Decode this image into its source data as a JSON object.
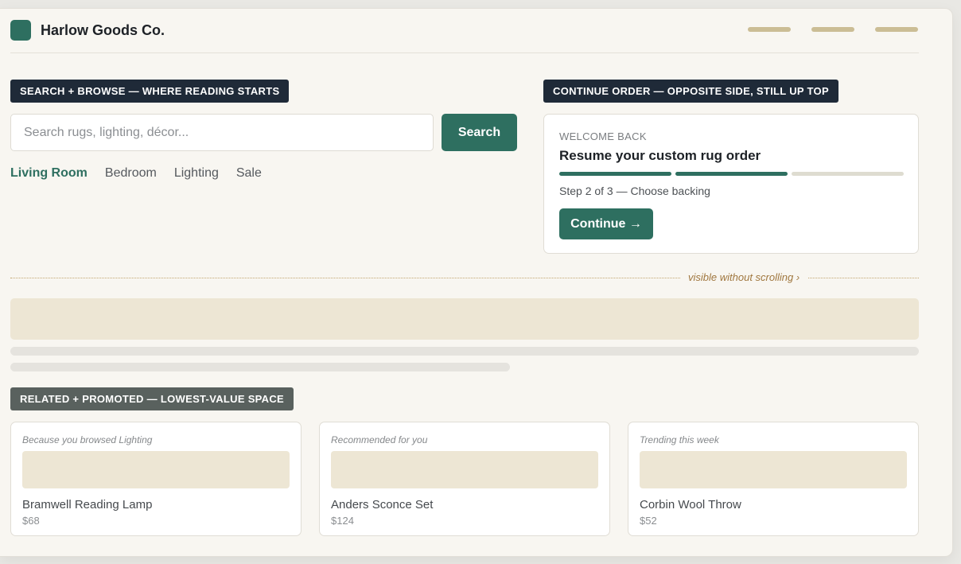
{
  "header": {
    "brand": "Harlow Goods Co.",
    "brand_color": "#2e6f60",
    "nav_placeholder_count": 3
  },
  "sections": {
    "search_tag": "Search + Browse — where reading starts",
    "continue_tag": "Continue order — opposite side, still up top",
    "related_tag": "Related + promoted — lowest-value space"
  },
  "search": {
    "placeholder": "Search rugs, lighting, décor...",
    "value": "",
    "button_label": "Search"
  },
  "categories": [
    {
      "label": "Living Room",
      "active": true
    },
    {
      "label": "Bedroom",
      "active": false
    },
    {
      "label": "Lighting",
      "active": false
    },
    {
      "label": "Sale",
      "active": false
    }
  ],
  "resume": {
    "eyebrow": "WELCOME BACK",
    "title": "Resume your custom rug order",
    "step_text": "Step 2 of 3 — Choose backing",
    "steps_completed": 2,
    "steps_total": 3,
    "button_label": "Continue →"
  },
  "fold": {
    "label": "visible without scrolling ›"
  },
  "products": [
    {
      "eyebrow": "Because you browsed Lighting",
      "name": "Bramwell Reading Lamp",
      "price": "$68"
    },
    {
      "eyebrow": "Recommended for you",
      "name": "Anders Sconce Set",
      "price": "$124"
    },
    {
      "eyebrow": "Trending this week",
      "name": "Corbin Wool Throw",
      "price": "$52"
    }
  ],
  "colors": {
    "accent": "#2e6f60",
    "tag_dark": "#1f2a38",
    "tag_grey": "#59615e",
    "nav_dash": "#cbbd95",
    "progress_done": "#2e6f60",
    "progress_todo": "#dedcd0",
    "fold_line": "#c2a46e"
  }
}
